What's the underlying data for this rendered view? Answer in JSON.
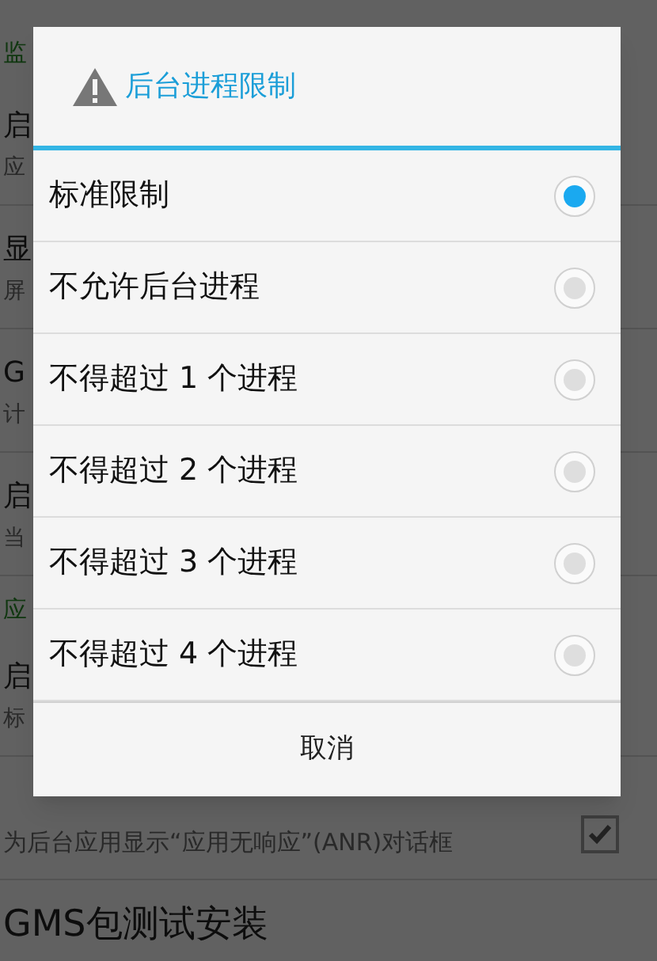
{
  "background_list": [
    {
      "kind": "section",
      "title": "监"
    },
    {
      "kind": "item",
      "title": "启",
      "subtitle": "应"
    },
    {
      "kind": "item",
      "title": "显",
      "subtitle": "屏"
    },
    {
      "kind": "item",
      "title": "G",
      "subtitle": "计"
    },
    {
      "kind": "item",
      "title": "启",
      "subtitle": "当"
    },
    {
      "kind": "section",
      "title": "应"
    },
    {
      "kind": "item",
      "title": "启",
      "subtitle": "标"
    },
    {
      "kind": "check",
      "subtitle": "为后台应用显示“应用无响应”(ANR)对话框",
      "checked": true
    },
    {
      "kind": "item",
      "title": "GMS包测试安装"
    }
  ],
  "dialog": {
    "title": "后台进程限制",
    "options": [
      {
        "label": "标准限制",
        "selected": true
      },
      {
        "label": "不允许后台进程",
        "selected": false
      },
      {
        "label": "不得超过 1 个进程",
        "selected": false
      },
      {
        "label": "不得超过 2 个进程",
        "selected": false
      },
      {
        "label": "不得超过 3 个进程",
        "selected": false
      },
      {
        "label": "不得超过 4 个进程",
        "selected": false
      }
    ],
    "cancel": "取消"
  }
}
